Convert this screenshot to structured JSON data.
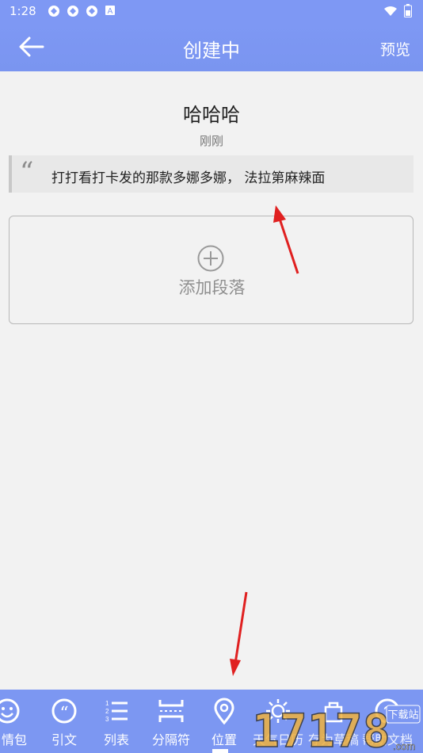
{
  "status_bar": {
    "time": "1:28",
    "icons": [
      "app-icon",
      "app-icon",
      "app-icon",
      "notification-a-icon"
    ],
    "right_icons": [
      "wifi-icon",
      "battery-icon"
    ]
  },
  "app_bar": {
    "title": "创建中",
    "action_label": "预览"
  },
  "document": {
    "title": "哈哈哈",
    "time": "刚刚",
    "quote": {
      "mark": "“",
      "text": "打打看打卡发的那款多娜多娜， 法拉第麻辣面"
    },
    "add_paragraph_label": "添加段落"
  },
  "toolbar": {
    "items": [
      {
        "label": "情包",
        "icon": "emoji-icon"
      },
      {
        "label": "引文",
        "icon": "quote-icon"
      },
      {
        "label": "列表",
        "icon": "list-icon"
      },
      {
        "label": "分隔符",
        "icon": "divider-icon"
      },
      {
        "label": "位置",
        "icon": "location-icon"
      },
      {
        "label": "天气日历",
        "icon": "weather-icon"
      },
      {
        "label": "存为草稿",
        "icon": "draft-icon"
      },
      {
        "label": "帮助文档",
        "icon": "help-icon"
      }
    ],
    "active_index": 4
  },
  "watermark": {
    "text": "17178.com",
    "badge": "下载站"
  },
  "colors": {
    "primary": "#7e98f4",
    "background": "#f2f2f2",
    "annotation_arrow": "#e02020"
  }
}
